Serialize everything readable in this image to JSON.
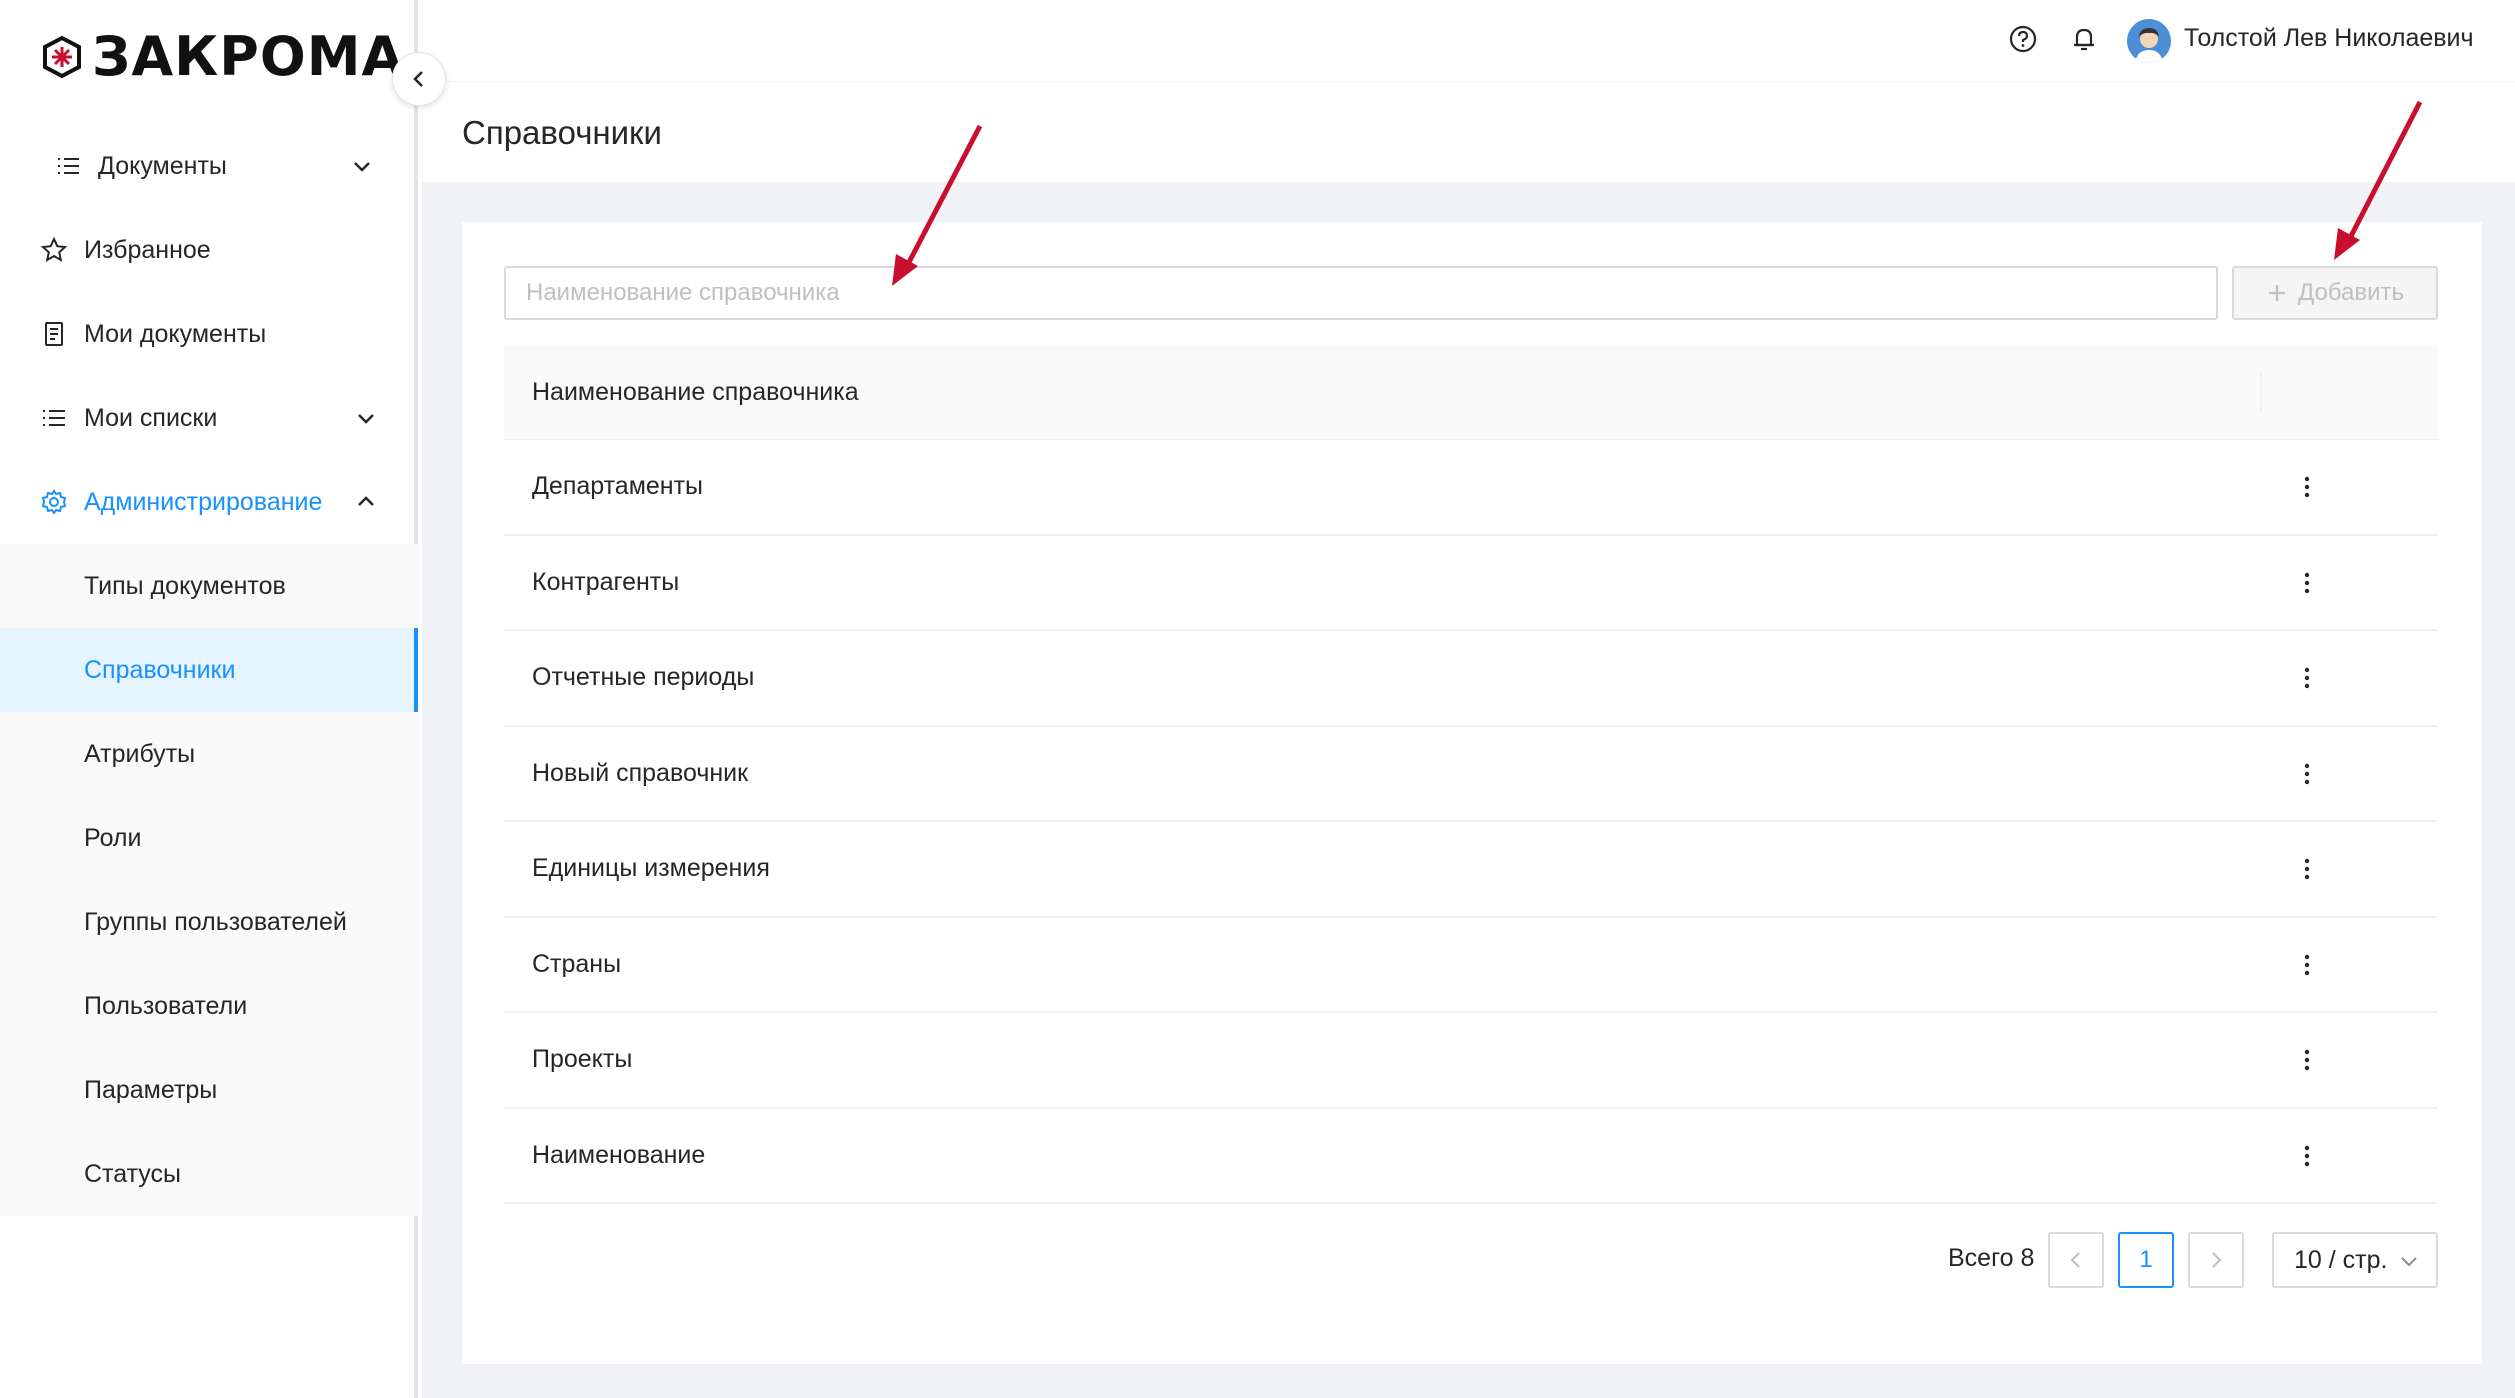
{
  "app": {
    "logo_text": "ЗАКРОМА"
  },
  "sidebar": {
    "items": [
      {
        "label": "Документы",
        "icon": "list-icon"
      },
      {
        "label": "Избранное",
        "icon": "star-icon"
      },
      {
        "label": "Мои документы",
        "icon": "document-icon"
      },
      {
        "label": "Мои списки",
        "icon": "list-icon"
      },
      {
        "label": "Администрирование",
        "icon": "gear-icon"
      }
    ],
    "admin_items": [
      {
        "label": "Типы документов"
      },
      {
        "label": "Справочники"
      },
      {
        "label": "Атрибуты"
      },
      {
        "label": "Роли"
      },
      {
        "label": "Группы пользователей"
      },
      {
        "label": "Пользователи"
      },
      {
        "label": "Параметры"
      },
      {
        "label": "Статусы"
      }
    ]
  },
  "header": {
    "user_name": "Толстой Лев Николаевич",
    "help_icon": "help-icon",
    "bell_icon": "bell-icon"
  },
  "page": {
    "title": "Справочники"
  },
  "search": {
    "placeholder": "Наименование справочника",
    "value": ""
  },
  "toolbar": {
    "add_label": "Добавить"
  },
  "table": {
    "header": "Наименование справочника",
    "rows": [
      "Департаменты",
      "Контрагенты",
      "Отчетные периоды",
      "Новый справочник",
      "Единицы измерения",
      "Страны",
      "Проекты",
      "Наименование"
    ]
  },
  "pagination": {
    "total_label": "Всего 8",
    "current_page": "1",
    "page_size": "10 / стр."
  },
  "colors": {
    "accent": "#1890ff",
    "annotation_arrow": "#c8102e"
  }
}
